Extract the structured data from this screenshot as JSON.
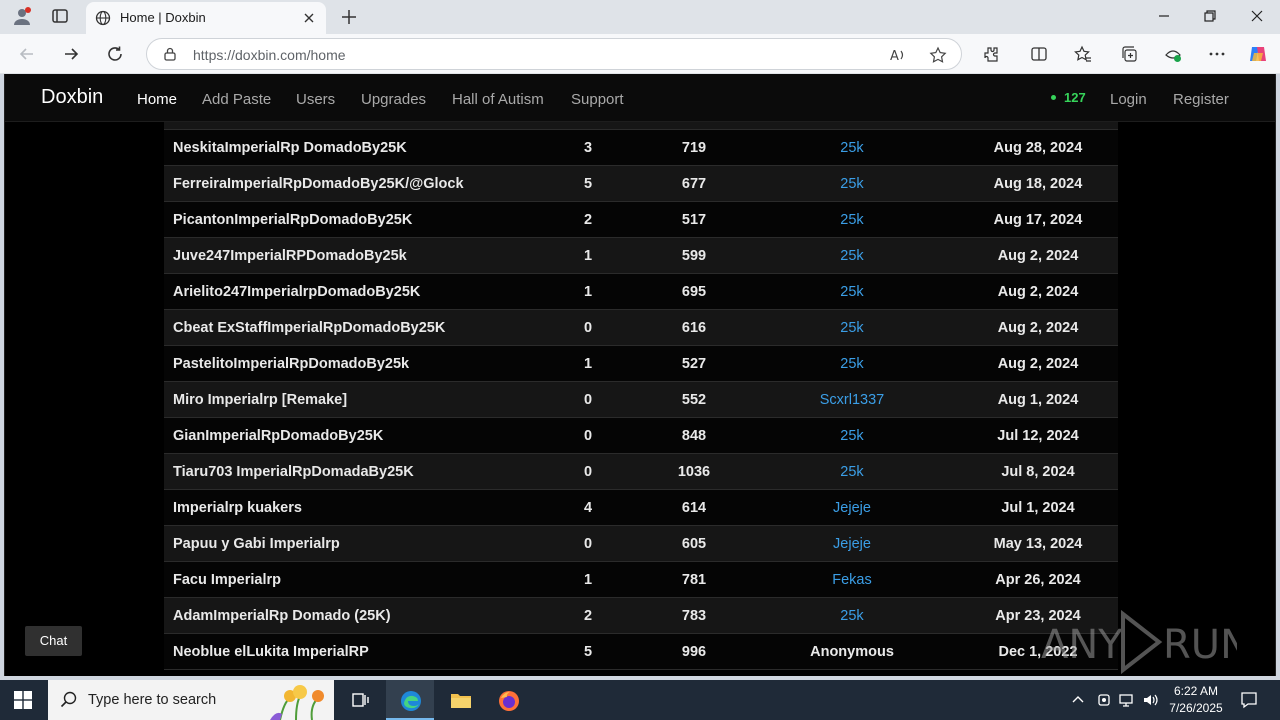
{
  "browser": {
    "tab_title": "Home | Doxbin",
    "url": "https://doxbin.com/home"
  },
  "site": {
    "brand": "Doxbin",
    "nav": [
      "Home",
      "Add Paste",
      "Users",
      "Upgrades",
      "Hall of Autism",
      "Support"
    ],
    "online_count": "127",
    "login": "Login",
    "register": "Register",
    "chat": "Chat"
  },
  "pastes": [
    {
      "title": "NeskitaImperialRp DomadoBy25K",
      "comments": "3",
      "views": "719",
      "author": "25k",
      "date": "Aug 28, 2024"
    },
    {
      "title": "FerreiraImperialRpDomadoBy25K/@Glock",
      "comments": "5",
      "views": "677",
      "author": "25k",
      "date": "Aug 18, 2024"
    },
    {
      "title": "PicantonImperialRpDomadoBy25K",
      "comments": "2",
      "views": "517",
      "author": "25k",
      "date": "Aug 17, 2024"
    },
    {
      "title": "Juve247ImperialRPDomadoBy25k",
      "comments": "1",
      "views": "599",
      "author": "25k",
      "date": "Aug 2, 2024"
    },
    {
      "title": "Arielito247ImperialrpDomadoBy25K",
      "comments": "1",
      "views": "695",
      "author": "25k",
      "date": "Aug 2, 2024"
    },
    {
      "title": "Cbeat ExStaffImperialRpDomadoBy25K",
      "comments": "0",
      "views": "616",
      "author": "25k",
      "date": "Aug 2, 2024"
    },
    {
      "title": "PastelitoImperialRpDomadoBy25k",
      "comments": "1",
      "views": "527",
      "author": "25k",
      "date": "Aug 2, 2024"
    },
    {
      "title": "Miro Imperialrp [Remake]",
      "comments": "0",
      "views": "552",
      "author": "Scxrl1337",
      "date": "Aug 1, 2024"
    },
    {
      "title": "GianImperialRpDomadoBy25K",
      "comments": "0",
      "views": "848",
      "author": "25k",
      "date": "Jul 12, 2024"
    },
    {
      "title": "Tiaru703 ImperialRpDomadaBy25K",
      "comments": "0",
      "views": "1036",
      "author": "25k",
      "date": "Jul 8, 2024"
    },
    {
      "title": "Imperialrp kuakers",
      "comments": "4",
      "views": "614",
      "author": "Jejeje",
      "date": "Jul 1, 2024"
    },
    {
      "title": "Papuu y Gabi Imperialrp",
      "comments": "0",
      "views": "605",
      "author": "Jejeje",
      "date": "May 13, 2024"
    },
    {
      "title": "Facu Imperialrp",
      "comments": "1",
      "views": "781",
      "author": "Fekas",
      "date": "Apr 26, 2024"
    },
    {
      "title": "AdamImperialRp Domado (25K)",
      "comments": "2",
      "views": "783",
      "author": "25k",
      "date": "Apr 23, 2024"
    },
    {
      "title": "Neoblue elLukita ImperialRP",
      "comments": "5",
      "views": "996",
      "author": "Anonymous",
      "date": "Dec 1, 2022"
    }
  ],
  "watermark": "ANY RUN",
  "taskbar": {
    "search_placeholder": "Type here to search",
    "time": "6:22 AM",
    "date": "7/26/2025"
  },
  "colors": {
    "link": "#3b9ee6",
    "online": "#36d35a",
    "background": "#000000"
  }
}
